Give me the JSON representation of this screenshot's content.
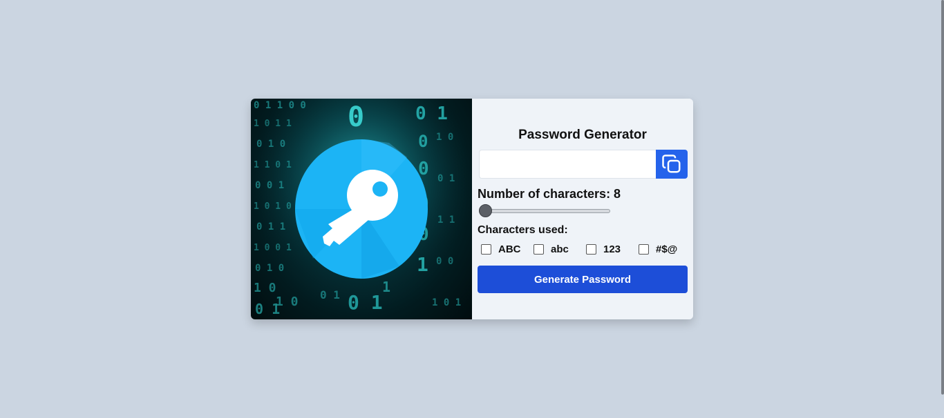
{
  "app": {
    "title": "Password Generator"
  },
  "password": {
    "value": "",
    "placeholder": ""
  },
  "copy_button": {
    "icon": "copy-icon"
  },
  "length": {
    "label": "Number of characters: 8",
    "value": 8
  },
  "charset": {
    "label": "Characters used:",
    "options": [
      {
        "label": "ABC",
        "checked": false
      },
      {
        "label": "abc",
        "checked": false
      },
      {
        "label": "123",
        "checked": false
      },
      {
        "label": "#$@",
        "checked": false
      }
    ]
  },
  "generate_button": {
    "label": "Generate Password"
  },
  "illustration": {
    "icon": "key-icon"
  },
  "colors": {
    "page_bg": "#cbd5e1",
    "panel_bg": "#eff3f8",
    "accent": "#1d4ed8",
    "copy_button_bg": "#2563eb",
    "key_circle": "#1cb4f5"
  }
}
